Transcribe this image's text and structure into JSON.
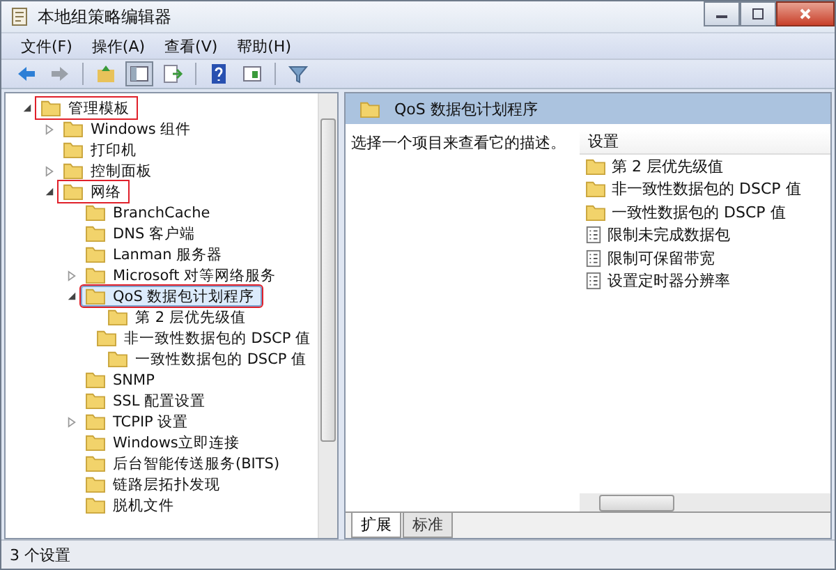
{
  "window": {
    "title": "本地组策略编辑器"
  },
  "menu": [
    "文件(F)",
    "操作(A)",
    "查看(V)",
    "帮助(H)"
  ],
  "toolbar": [
    {
      "kind": "back"
    },
    {
      "kind": "forward"
    },
    {
      "kind": "sep"
    },
    {
      "kind": "up"
    },
    {
      "kind": "tree",
      "selected": true
    },
    {
      "kind": "export"
    },
    {
      "kind": "sep"
    },
    {
      "kind": "help"
    },
    {
      "kind": "view"
    },
    {
      "kind": "sep"
    },
    {
      "kind": "filter"
    }
  ],
  "tree": [
    {
      "label": "管理模板",
      "expanded": true,
      "selected": false,
      "highlighted": true,
      "children": [
        {
          "label": "Windows 组件",
          "expanded": false,
          "selected": false,
          "highlighted": false
        },
        {
          "label": "打印机",
          "selected": false,
          "highlighted": false
        },
        {
          "label": "控制面板",
          "expanded": false,
          "selected": false,
          "highlighted": false
        },
        {
          "label": "网络",
          "expanded": true,
          "selected": false,
          "highlighted": true,
          "children": [
            {
              "label": "BranchCache",
              "selected": false,
              "highlighted": false
            },
            {
              "label": "DNS 客户端",
              "selected": false,
              "highlighted": false
            },
            {
              "label": "Lanman 服务器",
              "selected": false,
              "highlighted": false
            },
            {
              "label": "Microsoft 对等网络服务",
              "expanded": false,
              "selected": false,
              "highlighted": false
            },
            {
              "label": "QoS 数据包计划程序",
              "expanded": true,
              "selected": true,
              "highlighted": true,
              "children": [
                {
                  "label": "第 2 层优先级值",
                  "selected": false,
                  "highlighted": false
                },
                {
                  "label": "非一致性数据包的 DSCP 值",
                  "selected": false,
                  "highlighted": false
                },
                {
                  "label": "一致性数据包的 DSCP 值",
                  "selected": false,
                  "highlighted": false
                }
              ]
            },
            {
              "label": "SNMP",
              "selected": false,
              "highlighted": false
            },
            {
              "label": "SSL 配置设置",
              "selected": false,
              "highlighted": false
            },
            {
              "label": "TCPIP 设置",
              "expanded": false,
              "selected": false,
              "highlighted": false
            },
            {
              "label": "Windows立即连接",
              "selected": false,
              "highlighted": false
            },
            {
              "label": "后台智能传送服务(BITS)",
              "selected": false,
              "highlighted": false
            },
            {
              "label": "链路层拓扑发现",
              "selected": false,
              "highlighted": false
            },
            {
              "label": "脱机文件",
              "selected": false,
              "highlighted": false
            }
          ]
        }
      ]
    }
  ],
  "details": {
    "title": "QoS 数据包计划程序",
    "description": "选择一个项目来查看它的描述。",
    "column": "设置",
    "items": [
      {
        "kind": "folder",
        "label": "第 2 层优先级值"
      },
      {
        "kind": "folder",
        "label": "非一致性数据包的 DSCP 值"
      },
      {
        "kind": "folder",
        "label": "一致性数据包的 DSCP 值"
      },
      {
        "kind": "setting",
        "label": "限制未完成数据包"
      },
      {
        "kind": "setting",
        "label": "限制可保留带宽"
      },
      {
        "kind": "setting",
        "label": "设置定时器分辨率"
      }
    ],
    "tabs": [
      {
        "label": "扩展",
        "selected": true
      },
      {
        "label": "标准",
        "selected": false
      }
    ]
  },
  "status_bar": "3 个设置"
}
